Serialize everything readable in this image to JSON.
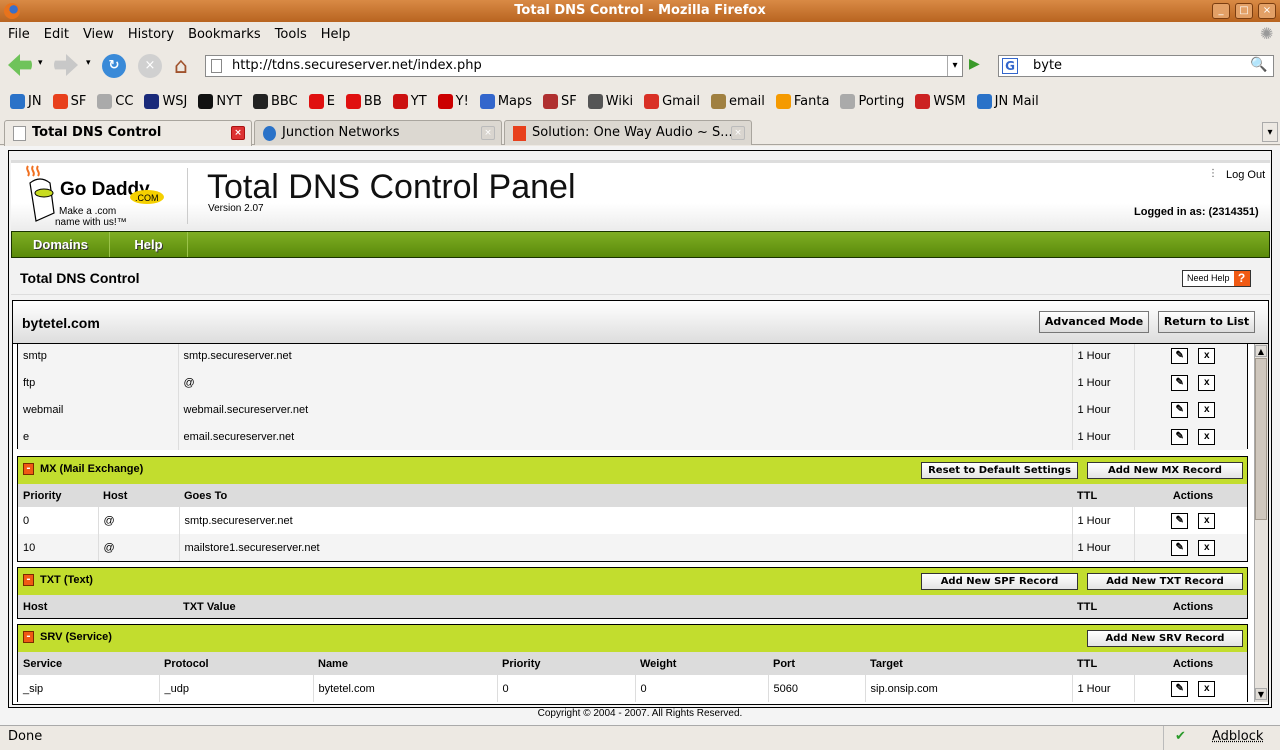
{
  "window": {
    "title": "Total DNS Control - Mozilla Firefox"
  },
  "menu": [
    "File",
    "Edit",
    "View",
    "History",
    "Bookmarks",
    "Tools",
    "Help"
  ],
  "url": "http://tdns.secureserver.net/index.php",
  "search": "byte",
  "bookmarks": [
    {
      "label": "JN",
      "color": "#2a72c8"
    },
    {
      "label": "SF",
      "color": "#e8401c"
    },
    {
      "label": "CC",
      "color": "#aaaaaa"
    },
    {
      "label": "WSJ",
      "color": "#1a2a7a"
    },
    {
      "label": "NYT",
      "color": "#111111"
    },
    {
      "label": "BBC",
      "color": "#222222"
    },
    {
      "label": "E",
      "color": "#e01010"
    },
    {
      "label": "BB",
      "color": "#e01010"
    },
    {
      "label": "YT",
      "color": "#cc1111"
    },
    {
      "label": "Y!",
      "color": "#cc0000"
    },
    {
      "label": "Maps",
      "color": "#3366cc"
    },
    {
      "label": "SF",
      "color": "#b03030"
    },
    {
      "label": "Wiki",
      "color": "#555555"
    },
    {
      "label": "Gmail",
      "color": "#d93025"
    },
    {
      "label": "email",
      "color": "#a08040"
    },
    {
      "label": "Fanta",
      "color": "#f59a00"
    },
    {
      "label": "Porting",
      "color": "#aaaaaa"
    },
    {
      "label": "WSM",
      "color": "#cc2222"
    },
    {
      "label": "JN Mail",
      "color": "#2a72c8"
    }
  ],
  "tabs": [
    {
      "label": "Total DNS Control",
      "active": true
    },
    {
      "label": "Junction Networks"
    },
    {
      "label": "Solution: One Way Audio ~ S..."
    }
  ],
  "page": {
    "logo_text": "Go Daddy .com Make a .com name with us!",
    "title": "Total DNS Control Panel",
    "version": "Version 2.07",
    "logout": "Log Out",
    "logged_in": "Logged in as: (2314351)",
    "nav": [
      "Domains",
      "Help"
    ],
    "subtitle": "Total DNS Control",
    "need_help": "Need Help",
    "help_icon": "?",
    "domain": "bytetel.com",
    "advanced_mode": "Advanced Mode",
    "return_to_list": "Return to List",
    "cname_rows": [
      [
        "smtp",
        "smtp.secureserver.net",
        "1 Hour"
      ],
      [
        "ftp",
        "@",
        "1 Hour"
      ],
      [
        "webmail",
        "webmail.secureserver.net",
        "1 Hour"
      ],
      [
        "e",
        "email.secureserver.net",
        "1 Hour"
      ]
    ],
    "mx": {
      "title": "MX (Mail Exchange)",
      "reset": "Reset to Default Settings",
      "add": "Add New MX Record",
      "columns": [
        "Priority",
        "Host",
        "Goes To",
        "TTL",
        "Actions"
      ],
      "rows": [
        [
          "0",
          "@",
          "smtp.secureserver.net",
          "1 Hour"
        ],
        [
          "10",
          "@",
          "mailstore1.secureserver.net",
          "1 Hour"
        ]
      ]
    },
    "txt": {
      "title": "TXT (Text)",
      "add_spf": "Add New SPF Record",
      "add": "Add New TXT Record",
      "columns": [
        "Host",
        "TXT Value",
        "TTL",
        "Actions"
      ],
      "rows": []
    },
    "srv": {
      "title": "SRV (Service)",
      "add": "Add New SRV Record",
      "columns": [
        "Service",
        "Protocol",
        "Name",
        "Priority",
        "Weight",
        "Port",
        "Target",
        "TTL",
        "Actions"
      ],
      "rows": [
        [
          "_sip",
          "_udp",
          "bytetel.com",
          "0",
          "0",
          "5060",
          "sip.onsip.com",
          "1 Hour"
        ]
      ]
    },
    "copyright": "Copyright © 2004 - 2007. All Rights Reserved."
  },
  "status": {
    "text": "Done",
    "adblock": "Adblock"
  }
}
